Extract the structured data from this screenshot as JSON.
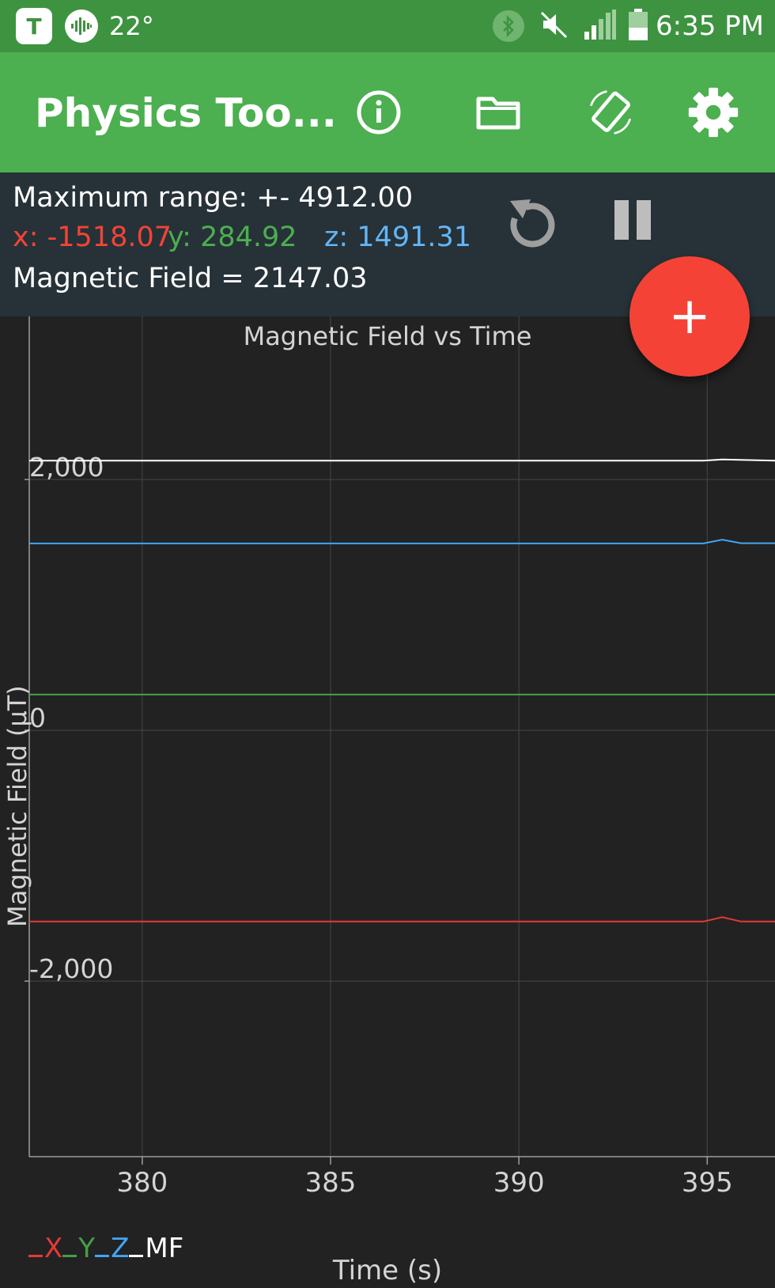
{
  "status_bar": {
    "app_icon_letter": "T",
    "temperature": "22°",
    "time": "6:35 PM"
  },
  "app_bar": {
    "title": "Physics Too...",
    "icons": [
      "info-icon",
      "folder-icon",
      "screen-rotation-icon",
      "settings-icon"
    ]
  },
  "readout": {
    "max_range_label": "Maximum range: +- 4912.00",
    "x_label": "x: -1518.07",
    "y_label": "y: 284.92",
    "z_label": "z: 1491.31",
    "field_label": "Magnetic Field =  2147.03",
    "colors": {
      "x": "#f44336",
      "y": "#4caf50",
      "z": "#64b5f6"
    }
  },
  "fab": {
    "label": "+"
  },
  "chart_data": {
    "type": "line",
    "title": "Magnetic Field vs Time",
    "xlabel": "Time (s)",
    "ylabel": "Magnetic Field (µT)",
    "xlim": [
      377,
      396.8
    ],
    "ylim": [
      -3400,
      3300
    ],
    "x_ticks": [
      380,
      385,
      390,
      395
    ],
    "x_tick_labels": [
      "380",
      "385",
      "390",
      "395"
    ],
    "y_ticks": [
      2000,
      0,
      -2000
    ],
    "y_tick_labels": [
      "2,000",
      "0",
      "-2,000"
    ],
    "grid": true,
    "legend_position": "bottom-left",
    "series": [
      {
        "name": "X",
        "color": "#e53935",
        "x": [
          377,
          394.9,
          395.4,
          395.9,
          396.8
        ],
        "y": [
          -1525,
          -1525,
          -1490,
          -1525,
          -1525
        ]
      },
      {
        "name": "Y",
        "color": "#43a047",
        "x": [
          377,
          396.8
        ],
        "y": [
          285,
          285
        ]
      },
      {
        "name": "Z",
        "color": "#42a5f5",
        "x": [
          377,
          394.9,
          395.4,
          395.9,
          396.8
        ],
        "y": [
          1490,
          1490,
          1520,
          1492,
          1492
        ]
      },
      {
        "name": "MF",
        "color": "#ffffff",
        "x": [
          377,
          394.9,
          395.4,
          396.8
        ],
        "y": [
          2150,
          2150,
          2160,
          2150
        ]
      }
    ]
  }
}
